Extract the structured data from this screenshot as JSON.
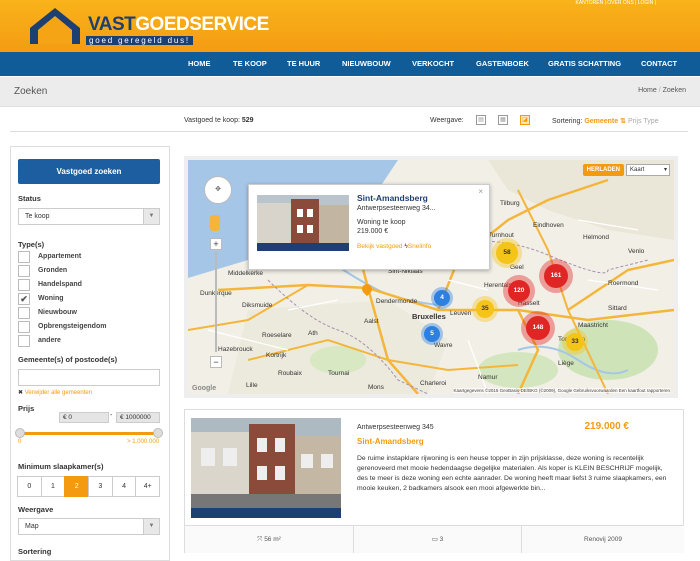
{
  "header": {
    "logo_part1": "VAST",
    "logo_part2": "GOEDSERVICE",
    "tagline": "goed geregeld dus!",
    "toplinks": "KANTOREN | OVER ONS | LOGIN |"
  },
  "nav": {
    "items": [
      "HOME",
      "TE KOOP",
      "TE HUUR",
      "NIEUWBOUW",
      "VERKOCHT",
      "GASTENBOEK",
      "GRATIS SCHATTING",
      "CONTACT"
    ]
  },
  "breadcrumb": {
    "title": "Zoeken",
    "home": "Home",
    "current": "Zoeken"
  },
  "results": {
    "count_label": "Vastgoed te koop:",
    "count": "529",
    "view_label": "Weergave:",
    "sort_label": "Sortering:",
    "sort_options": [
      "Gemeente",
      "Prijs",
      "Type"
    ]
  },
  "sidebar": {
    "search_button": "Vastgoed zoeken",
    "status_label": "Status",
    "status_value": "Te koop",
    "types_label": "Type(s)",
    "types": [
      {
        "label": "Appartement",
        "checked": false
      },
      {
        "label": "Gronden",
        "checked": false
      },
      {
        "label": "Handelspand",
        "checked": false
      },
      {
        "label": "Woning",
        "checked": true
      },
      {
        "label": "Nieuwbouw",
        "checked": false
      },
      {
        "label": "Opbrengsteigendom",
        "checked": false
      },
      {
        "label": "andere",
        "checked": false
      }
    ],
    "postcode_label": "Gemeente(s) of postcode(s)",
    "remove_link": "Verwijder alle gemeenten",
    "price_label": "Prijs",
    "price_min": "€ 0",
    "price_sep": "-",
    "price_max": "€ 1000000",
    "slider_min": "0",
    "slider_max": "> 1.000.000",
    "bedrooms_label": "Minimum slaapkamer(s)",
    "bedrooms": [
      "0",
      "1",
      "2",
      "3",
      "4",
      "4+"
    ],
    "bedrooms_selected": "2",
    "view_label": "Weergave",
    "view_value": "Map",
    "sort_label": "Sortering"
  },
  "map": {
    "reload_button": "HERLADEN",
    "maptype": "Kaart",
    "footer": "Kaartgegevens ©2015 GeoBasis-DE/BKG (©2009), Google   Gebruiksvoorwaarden   Een kaartfout rapporteren",
    "google": "Google",
    "cities": [
      "Sint-Niklaas",
      "Middelkerke",
      "Dunkerque",
      "Diksmuide",
      "Roeselare",
      "Kortrijk",
      "Hazebrouck",
      "Roubaix",
      "Lille",
      "Tournai",
      "Dendermonde",
      "Aalst",
      "Bruxelles",
      "Leuven",
      "Hasselt",
      "Maastricht",
      "Tongeren",
      "Namur",
      "Charleroi",
      "Mons",
      "Liège",
      "Tilburg",
      "Eindhoven",
      "Helmond",
      "Venlo",
      "Roermond",
      "Sittard",
      "Turnhout",
      "Geel",
      "Wavre",
      "Ath",
      "Herentals"
    ],
    "clusters": [
      {
        "label": "58",
        "color": "#f4c518"
      },
      {
        "label": "161",
        "color": "#e02525"
      },
      {
        "label": "120",
        "color": "#e02525"
      },
      {
        "label": "35",
        "color": "#f4c518"
      },
      {
        "label": "148",
        "color": "#e02525"
      },
      {
        "label": "33",
        "color": "#f4c518"
      },
      {
        "label": "4",
        "color": "#2d7fe0"
      },
      {
        "label": "5",
        "color": "#2d7fe0"
      }
    ],
    "popup": {
      "title": "Sint-Amandsberg",
      "address": "Antwerpsesteenweg 34...",
      "type": "Woning te koop",
      "price": "219.000 €",
      "link1": "Bekijk vastgoed",
      "link2": "Snelinfo"
    }
  },
  "listing": {
    "address": "Antwerpsesteenweg 345",
    "town": "Sint-Amandsberg",
    "price": "219.000 €",
    "description": "De ruime instapklare rijwoning is een heuse topper in zijn prijsklasse, deze woning is recentelijk gerenoveerd met mooie hedendaagse degelijke materialen. Als koper is KLEIN BESCHRIJF mogelijk, des te meer is deze woning een echte aanrader. De woning heeft maar liefst 3 ruime slaapkamers, een mooie keuken, 2 badkamers alsook een mooi afgewerkte bin...",
    "area": "56 m²",
    "bedrooms": "3",
    "renovated": "Renovij 2009"
  }
}
